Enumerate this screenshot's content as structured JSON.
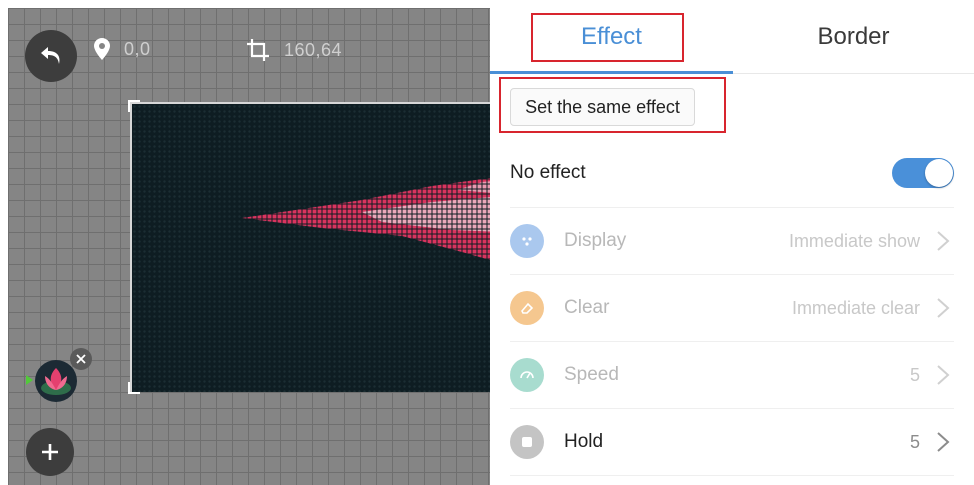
{
  "canvas": {
    "position_readout": "0,0",
    "size_readout": "160,64"
  },
  "tabs": {
    "effect_label": "Effect",
    "border_label": "Border",
    "active": "Effect"
  },
  "same_effect_button": "Set the same effect",
  "no_effect": {
    "label": "No effect",
    "enabled": true
  },
  "settings": [
    {
      "label": "Display",
      "value": "Immediate show",
      "icon": "display-icon",
      "icon_color": "#aac8ee",
      "state": "disabled"
    },
    {
      "label": "Clear",
      "value": "Immediate clear",
      "icon": "clear-icon",
      "icon_color": "#f5c78f",
      "state": "disabled"
    },
    {
      "label": "Speed",
      "value": "5",
      "icon": "speed-icon",
      "icon_color": "#a8dccf",
      "state": "disabled"
    },
    {
      "label": "Hold",
      "value": "5",
      "icon": "hold-icon",
      "icon_color": "#c4c4c4",
      "state": "enabled"
    }
  ],
  "colors": {
    "accent": "#4a8fd6",
    "highlight_box": "#d8252e",
    "led_color": "#d9345f"
  }
}
